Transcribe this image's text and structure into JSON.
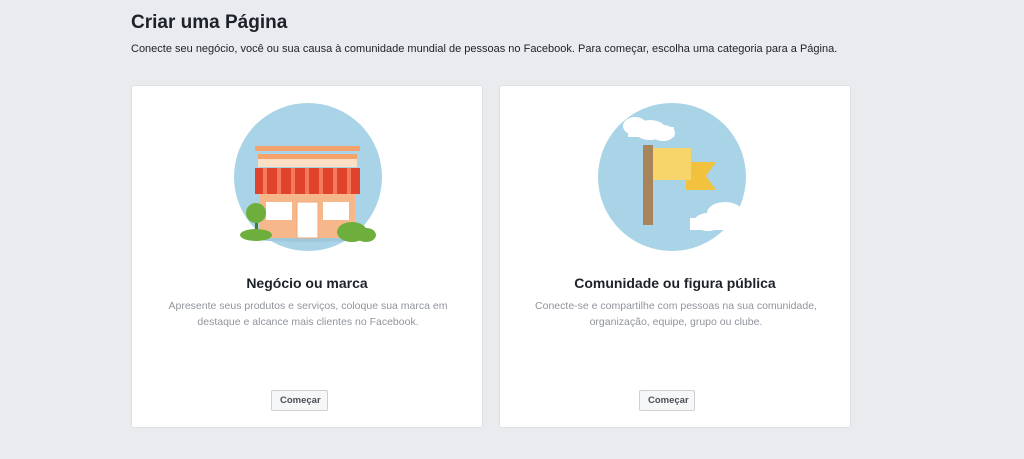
{
  "header": {
    "title": "Criar uma Página",
    "subtitle": "Conecte seu negócio, você ou sua causa à comunidade mundial de pessoas no Facebook. Para começar, escolha uma categoria para a Página."
  },
  "cards": [
    {
      "title": "Negócio ou marca",
      "description": "Apresente seus produtos e serviços, coloque sua marca em destaque e alcance mais clientes no Facebook.",
      "button_label": "Começar",
      "icon": "storefront-illustration"
    },
    {
      "title": "Comunidade ou figura pública",
      "description": "Conecte-se e compartilhe com pessoas na sua comunidade, organização, equipe, grupo ou clube.",
      "button_label": "Começar",
      "icon": "flag-illustration"
    }
  ],
  "colors": {
    "background": "#e9ebee",
    "illustration_sky": "#a9d3e6",
    "awning_red": "#e0422b",
    "flag_yellow": "#f7d56a"
  }
}
